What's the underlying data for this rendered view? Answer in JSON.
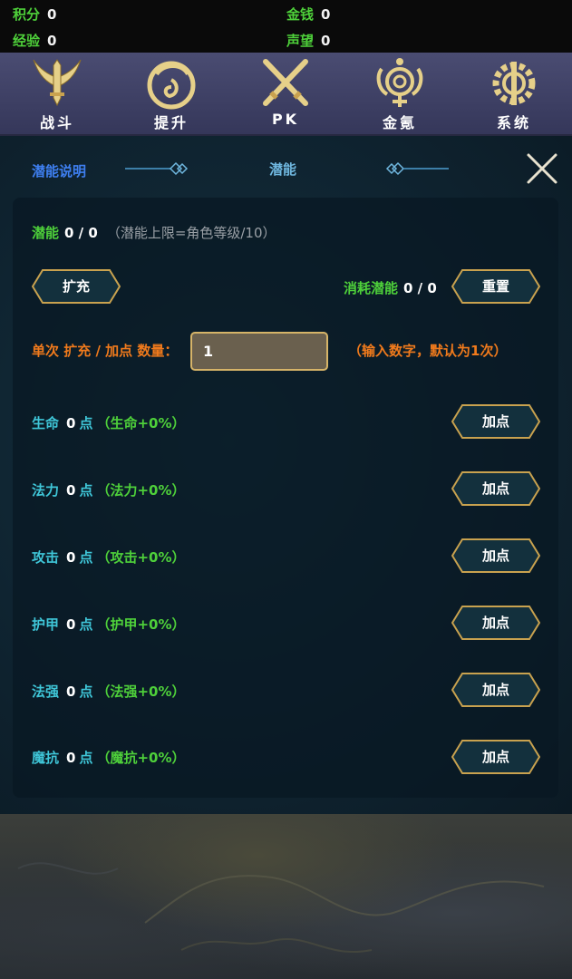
{
  "stats": {
    "points_label": "积分",
    "points_value": "0",
    "money_label": "金钱",
    "money_value": "0",
    "exp_label": "经验",
    "exp_value": "0",
    "fame_label": "声望",
    "fame_value": "0"
  },
  "nav": [
    {
      "label": "战斗",
      "icon": "sword-icon"
    },
    {
      "label": "提升",
      "icon": "swirl-icon"
    },
    {
      "label": "PK",
      "icon": "crossed-swords-icon"
    },
    {
      "label": "金氪",
      "icon": "ornament-icon"
    },
    {
      "label": "系统",
      "icon": "gear-icon"
    }
  ],
  "panel": {
    "tab_desc": "潜能说明",
    "tab_title": "潜能",
    "potential_label": "潜能",
    "potential_value": "0 / 0",
    "potential_note": "（潜能上限=角色等级/10）",
    "expand_label": "扩充",
    "consume_label": "消耗潜能",
    "consume_value": "0 / 0",
    "reset_label": "重置",
    "qty_label": "单次 扩充 / 加点 数量：",
    "qty_value": "1",
    "qty_hint": "（输入数字，默认为1次）",
    "unit_label": "点",
    "add_label": "加点",
    "attributes": [
      {
        "name": "生命",
        "points": "0",
        "bonus": "（生命+0%）"
      },
      {
        "name": "法力",
        "points": "0",
        "bonus": "（法力+0%）"
      },
      {
        "name": "攻击",
        "points": "0",
        "bonus": "（攻击+0%）"
      },
      {
        "name": "护甲",
        "points": "0",
        "bonus": "（护甲+0%）"
      },
      {
        "name": "法强",
        "points": "0",
        "bonus": "（法强+0%）"
      },
      {
        "name": "魔抗",
        "points": "0",
        "bonus": "（魔抗+0%）"
      }
    ]
  },
  "colors": {
    "label_green": "#4ed03a",
    "attr_cyan": "#3fc6d8",
    "hint_orange": "#f07a1c",
    "button_gold": "#c9a24f",
    "nav_bg": "#45476b"
  }
}
